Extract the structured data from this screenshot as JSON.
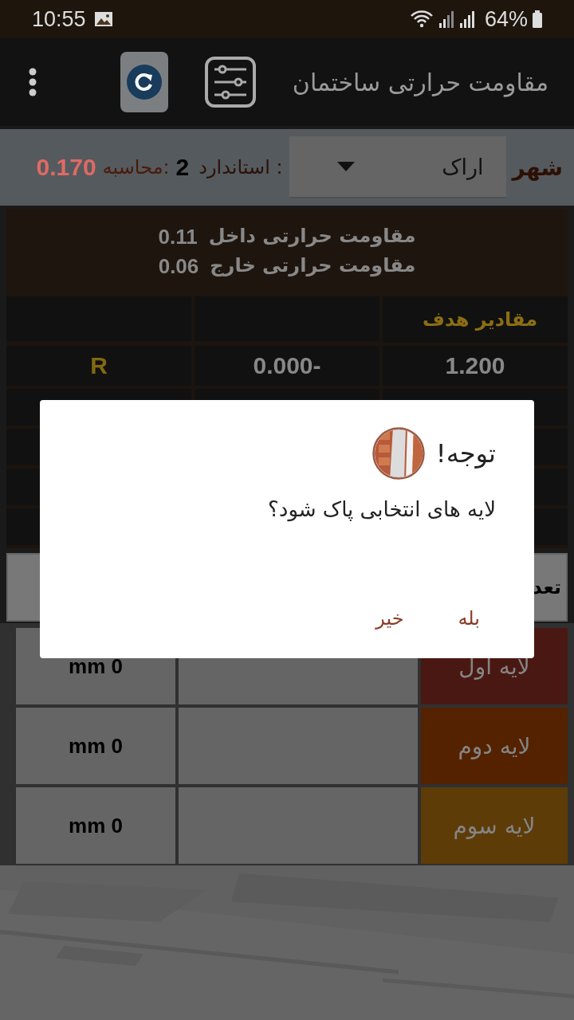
{
  "status_bar": {
    "time": "10:55",
    "battery": "64%"
  },
  "app_bar": {
    "title": "مقاومت حرارتی ساختمان"
  },
  "city": {
    "label": "شهر",
    "value": "اراک"
  },
  "standard": {
    "label": "استاندارد :",
    "value": "2",
    "calc_label": "محاسبه:",
    "calc_value": "0.170"
  },
  "resistances": [
    {
      "label": "مقاومت حرارتی داخل",
      "value": "0.11"
    },
    {
      "label": "مقاومت حرارتی خارج",
      "value": "0.06"
    }
  ],
  "results": {
    "header": "مقادیر هدف",
    "rows": [
      {
        "target": "1.200",
        "current": "0.000-",
        "name": "R"
      }
    ]
  },
  "layer_count": {
    "label": "تعد"
  },
  "layers": [
    {
      "name": "لایه اول",
      "color": "#4a1812",
      "thickness": "mm 0"
    },
    {
      "name": "لایه دوم",
      "color": "#552200",
      "thickness": "mm 0"
    },
    {
      "name": "لایه سوم",
      "color": "#5e3c08",
      "thickness": "mm 0"
    }
  ],
  "dialog": {
    "title": "توجه!",
    "message": "لایه های انتخابی پاک شود؟",
    "buttons": [
      "بله",
      "خیر"
    ]
  }
}
